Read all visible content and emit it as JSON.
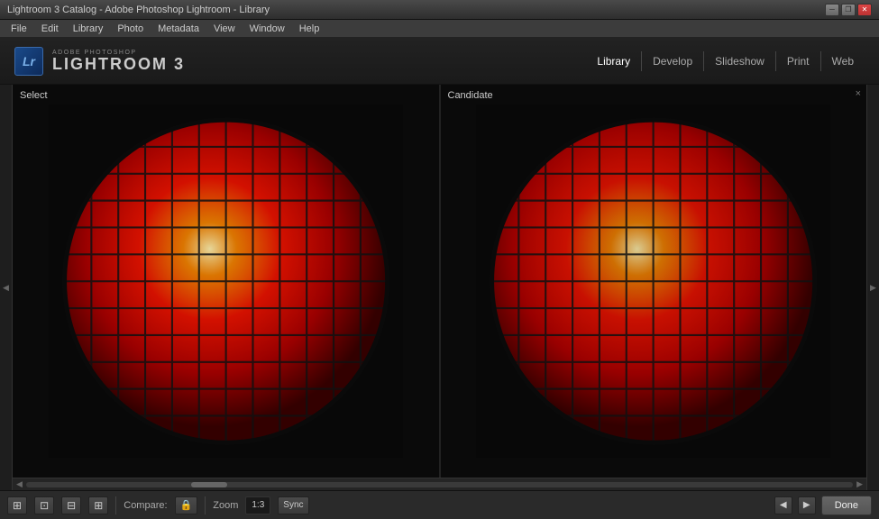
{
  "titleBar": {
    "text": "Lightroom 3 Catalog - Adobe Photoshop Lightroom - Library",
    "minimizeLabel": "─",
    "restoreLabel": "❐",
    "closeLabel": "✕"
  },
  "menuBar": {
    "items": [
      "File",
      "Edit",
      "Library",
      "Photo",
      "Metadata",
      "View",
      "Window",
      "Help"
    ]
  },
  "header": {
    "badge": "Lr",
    "adobeText": "ADOBE PHOTOSHOP",
    "lightroomText": "LIGHTROOM 3",
    "navTabs": [
      "Library",
      "Develop",
      "Slideshow",
      "Print",
      "Web"
    ]
  },
  "panels": {
    "left": {
      "label": "Select",
      "closeLabel": "×"
    },
    "right": {
      "label": "Candidate",
      "closeLabel": "×"
    }
  },
  "toolbar": {
    "compareLabel": "Compare:",
    "lockIcon": "🔒",
    "zoomLabel": "Zoom",
    "zoomValue": "1:3",
    "syncLabel": "Sync",
    "doneLabel": "Done"
  },
  "icons": {
    "leftArrow": "◀",
    "gridIcon": "⊞",
    "loupe": "⊡",
    "compare": "⊟",
    "survey": "⊞",
    "prevArrow": "◀",
    "nextArrow": "▶"
  }
}
